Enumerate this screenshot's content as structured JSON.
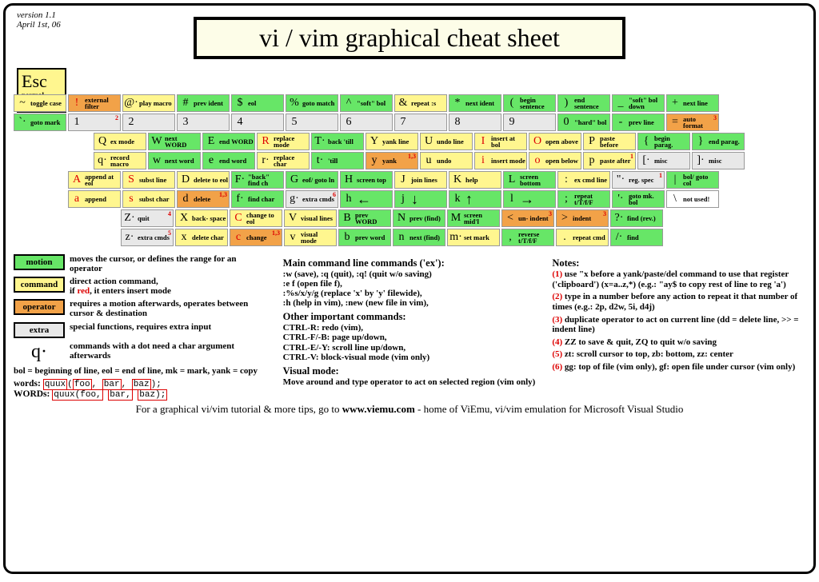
{
  "meta": {
    "version": "version 1.1",
    "date": "April 1st, 06"
  },
  "title": "vi / vim graphical cheat sheet",
  "esc": {
    "key": "Esc",
    "label": "normal mode"
  },
  "rows": [
    [
      {
        "top": {
          "g": "~",
          "d": "toggle case",
          "c": "command"
        },
        "bot": {
          "g": "`·",
          "d": "goto mark",
          "c": "motion"
        }
      },
      {
        "top": {
          "g": "!",
          "d": "external filter",
          "c": "operator",
          "red": true
        },
        "bot": {
          "g": "1",
          "d": "",
          "c": "extra",
          "sup": "2"
        }
      },
      {
        "top": {
          "g": "@·",
          "d": "play macro",
          "c": "command"
        },
        "bot": {
          "g": "2",
          "d": "",
          "c": "extra"
        }
      },
      {
        "top": {
          "g": "#",
          "d": "prev ident",
          "c": "motion"
        },
        "bot": {
          "g": "3",
          "d": "",
          "c": "extra"
        }
      },
      {
        "top": {
          "g": "$",
          "d": "eol",
          "c": "motion"
        },
        "bot": {
          "g": "4",
          "d": "",
          "c": "extra"
        }
      },
      {
        "top": {
          "g": "%",
          "d": "goto match",
          "c": "motion"
        },
        "bot": {
          "g": "5",
          "d": "",
          "c": "extra"
        }
      },
      {
        "top": {
          "g": "^",
          "d": "\"soft\" bol",
          "c": "motion"
        },
        "bot": {
          "g": "6",
          "d": "",
          "c": "extra"
        }
      },
      {
        "top": {
          "g": "&",
          "d": "repeat :s",
          "c": "command"
        },
        "bot": {
          "g": "7",
          "d": "",
          "c": "extra"
        }
      },
      {
        "top": {
          "g": "*",
          "d": "next ident",
          "c": "motion"
        },
        "bot": {
          "g": "8",
          "d": "",
          "c": "extra"
        }
      },
      {
        "top": {
          "g": "(",
          "d": "begin sentence",
          "c": "motion"
        },
        "bot": {
          "g": "9",
          "d": "",
          "c": "extra"
        }
      },
      {
        "top": {
          "g": ")",
          "d": "end sentence",
          "c": "motion"
        },
        "bot": {
          "g": "0",
          "d": "\"hard\" bol",
          "c": "motion"
        }
      },
      {
        "top": {
          "g": "_",
          "d": "\"soft\" bol down",
          "c": "motion"
        },
        "bot": {
          "g": "-",
          "d": "prev line",
          "c": "motion"
        }
      },
      {
        "top": {
          "g": "+",
          "d": "next line",
          "c": "motion"
        },
        "bot": {
          "g": "=",
          "d": "auto format",
          "c": "operator",
          "sup": "3"
        }
      }
    ],
    [
      {
        "top": {
          "g": "Q",
          "d": "ex mode",
          "c": "command"
        },
        "bot": {
          "g": "q·",
          "d": "record macro",
          "c": "command"
        }
      },
      {
        "top": {
          "g": "W",
          "d": "next WORD",
          "c": "motion"
        },
        "bot": {
          "g": "w",
          "d": "next word",
          "c": "motion"
        }
      },
      {
        "top": {
          "g": "E",
          "d": "end WORD",
          "c": "motion"
        },
        "bot": {
          "g": "e",
          "d": "end word",
          "c": "motion"
        }
      },
      {
        "top": {
          "g": "R",
          "d": "replace mode",
          "c": "command",
          "red": true
        },
        "bot": {
          "g": "r·",
          "d": "replace char",
          "c": "command"
        }
      },
      {
        "top": {
          "g": "T·",
          "d": "back 'till",
          "c": "motion"
        },
        "bot": {
          "g": "t·",
          "d": "'till",
          "c": "motion"
        }
      },
      {
        "top": {
          "g": "Y",
          "d": "yank line",
          "c": "command"
        },
        "bot": {
          "g": "y",
          "d": "yank",
          "c": "operator",
          "sup": "1,3"
        }
      },
      {
        "top": {
          "g": "U",
          "d": "undo line",
          "c": "command"
        },
        "bot": {
          "g": "u",
          "d": "undo",
          "c": "command"
        }
      },
      {
        "top": {
          "g": "I",
          "d": "insert at bol",
          "c": "command",
          "red": true
        },
        "bot": {
          "g": "i",
          "d": "insert mode",
          "c": "command",
          "red": true
        }
      },
      {
        "top": {
          "g": "O",
          "d": "open above",
          "c": "command",
          "red": true
        },
        "bot": {
          "g": "o",
          "d": "open below",
          "c": "command",
          "red": true
        }
      },
      {
        "top": {
          "g": "P",
          "d": "paste before",
          "c": "command"
        },
        "bot": {
          "g": "p",
          "d": "paste after",
          "c": "command",
          "sup": "1"
        }
      },
      {
        "top": {
          "g": "{",
          "d": "begin parag.",
          "c": "motion"
        },
        "bot": {
          "g": "[·",
          "d": "misc",
          "c": "extra"
        }
      },
      {
        "top": {
          "g": "}",
          "d": "end parag.",
          "c": "motion"
        },
        "bot": {
          "g": "]·",
          "d": "misc",
          "c": "extra"
        }
      }
    ],
    [
      {
        "top": {
          "g": "A",
          "d": "append at eol",
          "c": "command",
          "red": true
        },
        "bot": {
          "g": "a",
          "d": "append",
          "c": "command",
          "red": true
        }
      },
      {
        "top": {
          "g": "S",
          "d": "subst line",
          "c": "command",
          "red": true
        },
        "bot": {
          "g": "s",
          "d": "subst char",
          "c": "command",
          "red": true
        }
      },
      {
        "top": {
          "g": "D",
          "d": "delete to eol",
          "c": "command"
        },
        "bot": {
          "g": "d",
          "d": "delete",
          "c": "operator",
          "sup": "1,3"
        }
      },
      {
        "top": {
          "g": "F·",
          "d": "\"back\" find ch",
          "c": "motion"
        },
        "bot": {
          "g": "f·",
          "d": "find char",
          "c": "motion"
        }
      },
      {
        "top": {
          "g": "G",
          "d": "eof/ goto ln",
          "c": "motion"
        },
        "bot": {
          "g": "g·",
          "d": "extra cmds",
          "c": "extra",
          "sup": "6"
        }
      },
      {
        "top": {
          "g": "H",
          "d": "screen top",
          "c": "motion"
        },
        "bot": {
          "g": "h",
          "d": "←",
          "c": "motion",
          "arrow": true
        }
      },
      {
        "top": {
          "g": "J",
          "d": "join lines",
          "c": "command"
        },
        "bot": {
          "g": "j",
          "d": "↓",
          "c": "motion",
          "arrow": true
        }
      },
      {
        "top": {
          "g": "K",
          "d": "help",
          "c": "command"
        },
        "bot": {
          "g": "k",
          "d": "↑",
          "c": "motion",
          "arrow": true
        }
      },
      {
        "top": {
          "g": "L",
          "d": "screen bottom",
          "c": "motion"
        },
        "bot": {
          "g": "l",
          "d": "→",
          "c": "motion",
          "arrow": true
        }
      },
      {
        "top": {
          "g": ":",
          "d": "ex cmd line",
          "c": "command"
        },
        "bot": {
          "g": ";",
          "d": "repeat t/T/f/F",
          "c": "motion"
        }
      },
      {
        "top": {
          "g": "\"·",
          "d": "reg. spec",
          "c": "extra",
          "sup": "1"
        },
        "bot": {
          "g": "'·",
          "d": "goto mk. bol",
          "c": "motion"
        }
      },
      {
        "top": {
          "g": "|",
          "d": "bol/ goto col",
          "c": "motion"
        },
        "bot": {
          "g": "\\",
          "d": "not used!",
          "c": "unused"
        }
      }
    ],
    [
      {
        "top": {
          "g": "Z·",
          "d": "quit",
          "c": "extra",
          "sup": "4"
        },
        "bot": {
          "g": "z·",
          "d": "extra cmds",
          "c": "extra",
          "sup": "5"
        }
      },
      {
        "top": {
          "g": "X",
          "d": "back- space",
          "c": "command"
        },
        "bot": {
          "g": "x",
          "d": "delete char",
          "c": "command"
        }
      },
      {
        "top": {
          "g": "C",
          "d": "change to eol",
          "c": "command",
          "red": true
        },
        "bot": {
          "g": "c",
          "d": "change",
          "c": "operator",
          "red": true,
          "sup": "1,3"
        }
      },
      {
        "top": {
          "g": "V",
          "d": "visual lines",
          "c": "command"
        },
        "bot": {
          "g": "v",
          "d": "visual mode",
          "c": "command"
        }
      },
      {
        "top": {
          "g": "B",
          "d": "prev WORD",
          "c": "motion"
        },
        "bot": {
          "g": "b",
          "d": "prev word",
          "c": "motion"
        }
      },
      {
        "top": {
          "g": "N",
          "d": "prev (find)",
          "c": "motion"
        },
        "bot": {
          "g": "n",
          "d": "next (find)",
          "c": "motion"
        }
      },
      {
        "top": {
          "g": "M",
          "d": "screen mid'l",
          "c": "motion"
        },
        "bot": {
          "g": "m·",
          "d": "set mark",
          "c": "command"
        }
      },
      {
        "top": {
          "g": "<",
          "d": "un- indent",
          "c": "operator",
          "sup": "3"
        },
        "bot": {
          "g": ",",
          "d": "reverse t/T/f/F",
          "c": "motion"
        }
      },
      {
        "top": {
          "g": ">",
          "d": "indent",
          "c": "operator",
          "sup": "3"
        },
        "bot": {
          "g": ".",
          "d": "repeat cmd",
          "c": "command"
        }
      },
      {
        "top": {
          "g": "?·",
          "d": "find (rev.)",
          "c": "motion"
        },
        "bot": {
          "g": "/·",
          "d": "find",
          "c": "motion"
        }
      }
    ]
  ],
  "legend": [
    {
      "c": "motion",
      "label": "motion",
      "txt": "moves the cursor, or defines the range for an operator"
    },
    {
      "c": "command",
      "label": "command",
      "txt": "direct action command, if red, it enters insert mode"
    },
    {
      "c": "operator",
      "label": "operator",
      "txt": "requires a motion afterwards, operates between cursor & destination"
    },
    {
      "c": "extra",
      "label": "extra",
      "txt": "special functions, requires extra input"
    }
  ],
  "qlegend": "commands with a dot need a char argument afterwards",
  "abbrev": "bol = beginning of line, eol = end of line, mk = mark, yank = copy",
  "words_label": "words:",
  "WORDS_label": "WORDs:",
  "main_h": "Main command line commands ('ex'):",
  "main_t": ":w (save), :q (quit), :q! (quit w/o saving)\n:e f (open file f),\n:%s/x/y/g (replace 'x' by 'y' filewide),\n:h (help in vim), :new (new file in vim),",
  "other_h": "Other important commands:",
  "other_t": "CTRL-R: redo (vim),\nCTRL-F/-B: page up/down,\nCTRL-E/-Y: scroll line up/down,\nCTRL-V: block-visual mode (vim only)",
  "visual_h": "Visual mode:",
  "visual_t": "Move around and type operator to act on selected region (vim only)",
  "notes_h": "Notes:",
  "notes": [
    "use \"x before a yank/paste/del command to use that register ('clipboard') (x=a..z,*) (e.g.: \"ay$ to copy rest of line to reg 'a')",
    "type in a number before any action to repeat it that number of times (e.g.: 2p, d2w, 5i, d4j)",
    "duplicate operator to act on current line (dd = delete line, >> = indent line)",
    "ZZ to save & quit, ZQ to quit w/o saving",
    "zt: scroll cursor to top, zb: bottom, zz: center",
    "gg: top of file (vim only), gf: open file under cursor (vim only)"
  ],
  "footer_pre": "For a graphical vi/vim tutorial & more tips, go to ",
  "footer_url": "www.viemu.com",
  "footer_post": " - home of ViEmu, vi/vim emulation for Microsoft Visual Studio"
}
